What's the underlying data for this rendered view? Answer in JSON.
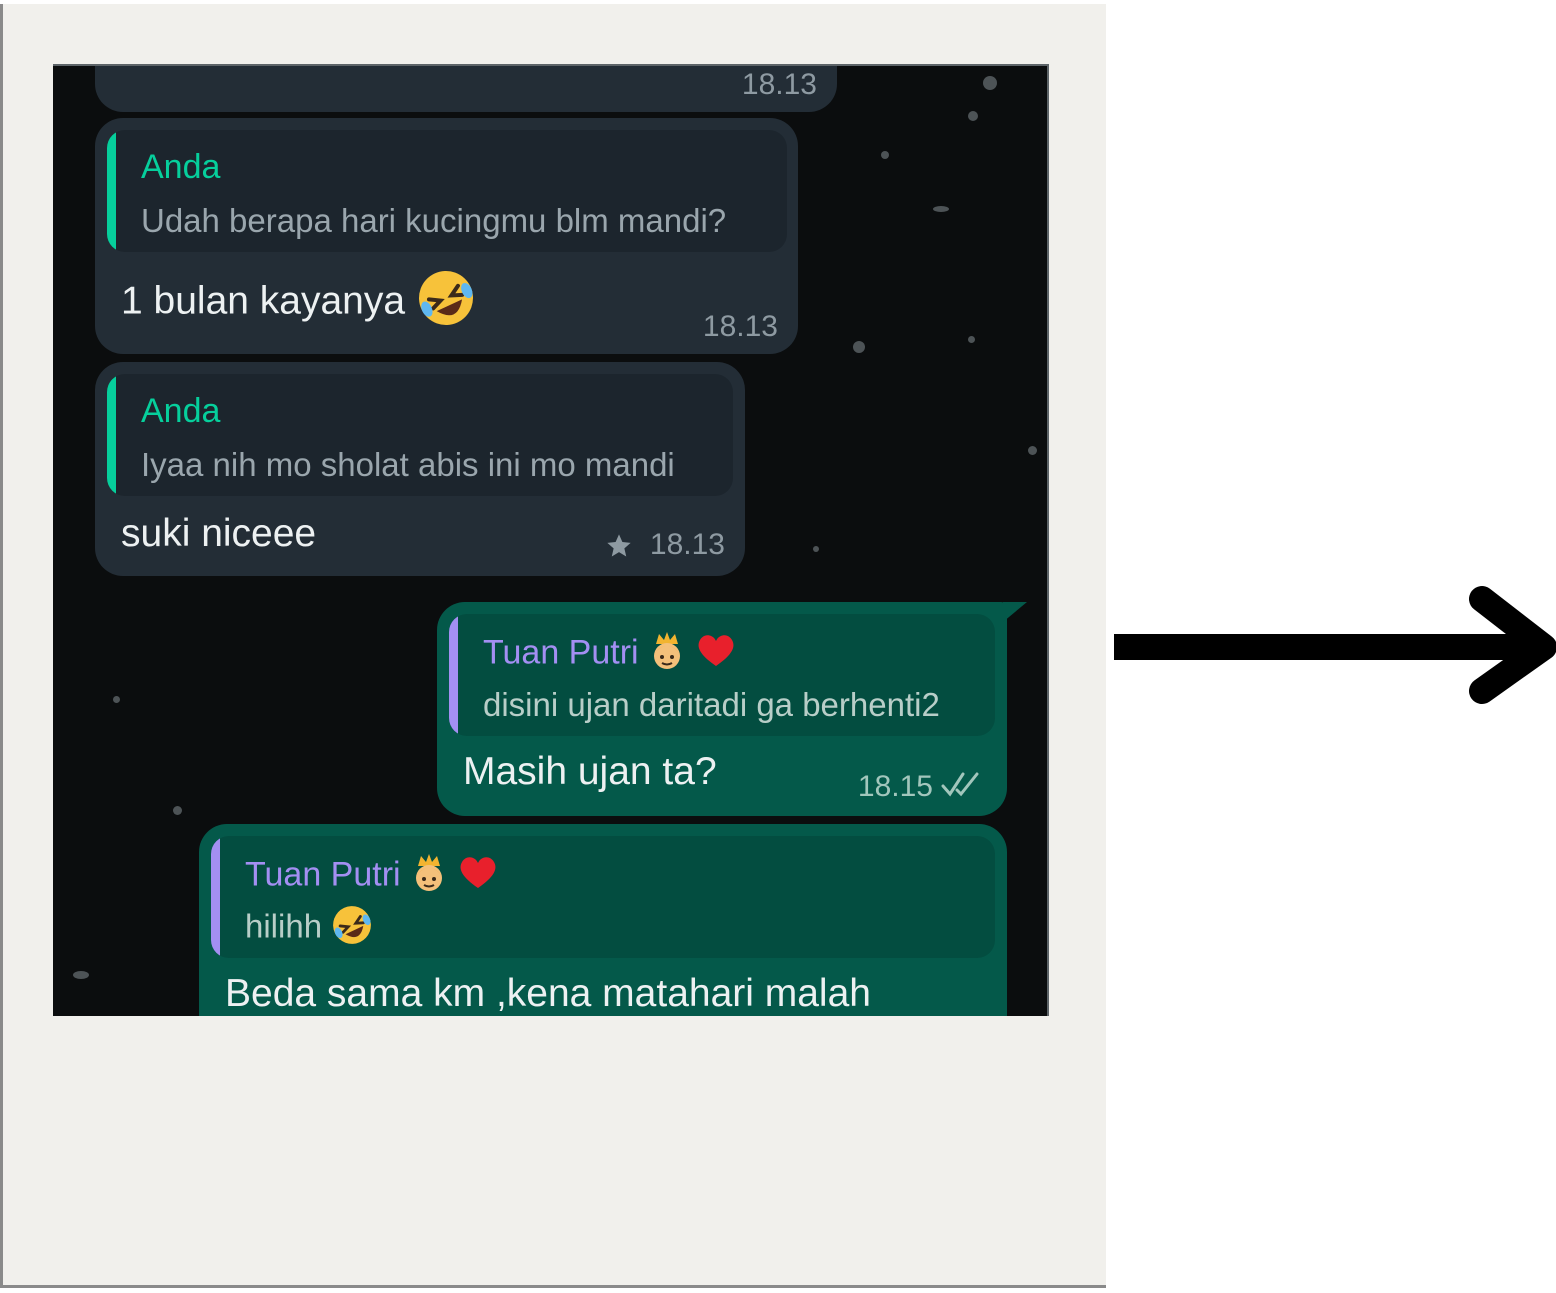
{
  "chat": {
    "messages": [
      {
        "partial_top_time": "18.13"
      },
      {
        "quote_author": "Anda",
        "quote_text": "Udah berapa hari kucingmu blm mandi?",
        "text": "1 bulan kayanya",
        "time": "18.13",
        "emoji": "laughing-face-icon"
      },
      {
        "quote_author": "Anda",
        "quote_text": "Iyaa nih mo sholat abis ini mo mandi",
        "text": "suki niceee",
        "time": "18.13",
        "starred": true
      },
      {
        "quote_author": "Tuan Putri",
        "quote_text": "disini ujan daritadi ga berhenti2",
        "text": "Masih ujan ta?",
        "time": "18.15",
        "status": "read-double-check"
      },
      {
        "quote_author": "Tuan Putri",
        "quote_text": "hilihh",
        "text": "Beda sama km ,kena matahari malah"
      }
    ]
  },
  "colors": {
    "incoming_bubble": "#232d36",
    "outgoing_bubble": "#04594a",
    "quote_green": "#06cf9c",
    "quote_purple": "#a38ff2"
  }
}
